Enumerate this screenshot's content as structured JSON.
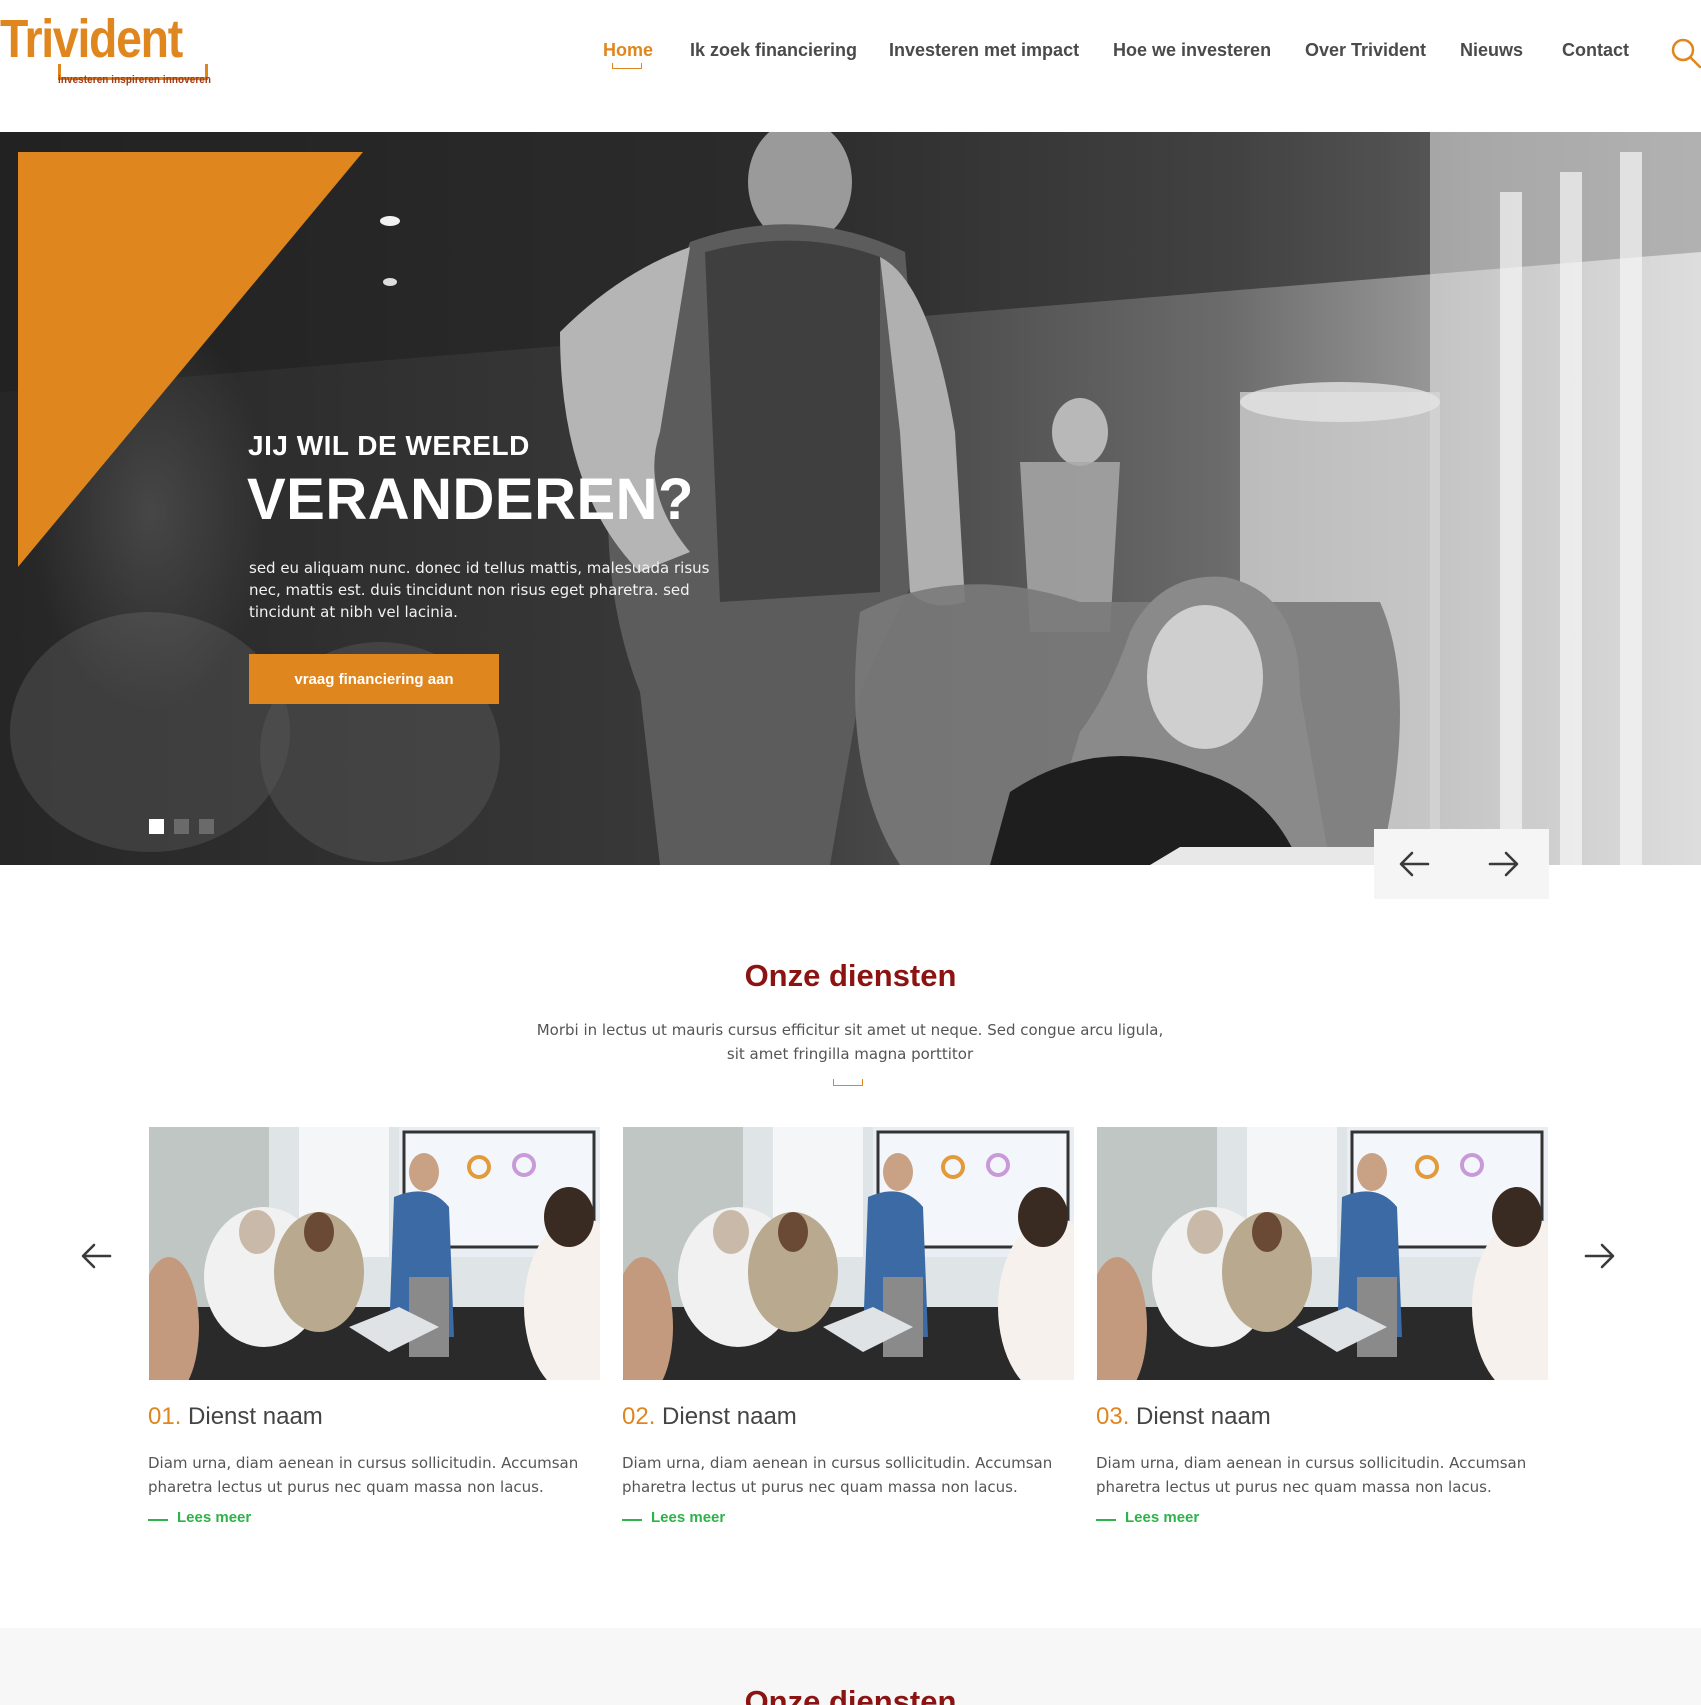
{
  "header": {
    "logo": {
      "name": "Trivident",
      "tagline": "investeren inspireren innoveren"
    },
    "nav": [
      {
        "label": "Home",
        "active": true
      },
      {
        "label": "Ik zoek financiering",
        "active": false
      },
      {
        "label": "Investeren met impact",
        "active": false
      },
      {
        "label": "Hoe we investeren",
        "active": false
      },
      {
        "label": "Over Trivident",
        "active": false
      },
      {
        "label": "Nieuws",
        "active": false
      },
      {
        "label": "Contact",
        "active": false
      }
    ],
    "search_icon": "search-icon"
  },
  "hero": {
    "kicker": "JIJ WIL DE WERELD",
    "title": "VERANDEREN?",
    "text": "sed eu aliquam nunc. donec id tellus mattis, malesuada risus nec, mattis est. duis tincidunt non risus eget pharetra. sed tincidunt at nibh vel lacinia.",
    "cta_label": "vraag financiering aan",
    "slides": 3,
    "active_slide": 1,
    "prev_icon": "arrow-left-icon",
    "next_icon": "arrow-right-icon"
  },
  "services": {
    "title": "Onze diensten",
    "subtitle": "Morbi in lectus ut mauris cursus efficitur sit amet ut neque. Sed congue arcu ligula, sit amet fringilla magna porttitor",
    "cards": [
      {
        "number": "01.",
        "name": "Dienst naam",
        "description": "Diam urna, diam aenean in cursus sollicitudin. Accumsan pharetra lectus ut purus nec quam massa non lacus.",
        "link": "Lees meer"
      },
      {
        "number": "02.",
        "name": "Dienst naam",
        "description": "Diam urna, diam aenean in cursus sollicitudin. Accumsan pharetra lectus ut purus nec quam massa non lacus.",
        "link": "Lees meer"
      },
      {
        "number": "03.",
        "name": "Dienst naam",
        "description": "Diam urna, diam aenean in cursus sollicitudin. Accumsan pharetra lectus ut purus nec quam massa non lacus.",
        "link": "Lees meer"
      }
    ]
  },
  "second_section": {
    "title": "Onze diensten"
  },
  "colors": {
    "accent": "#e0861e",
    "heading": "#8b1412",
    "link": "#2eb24a",
    "text": "#555555"
  }
}
